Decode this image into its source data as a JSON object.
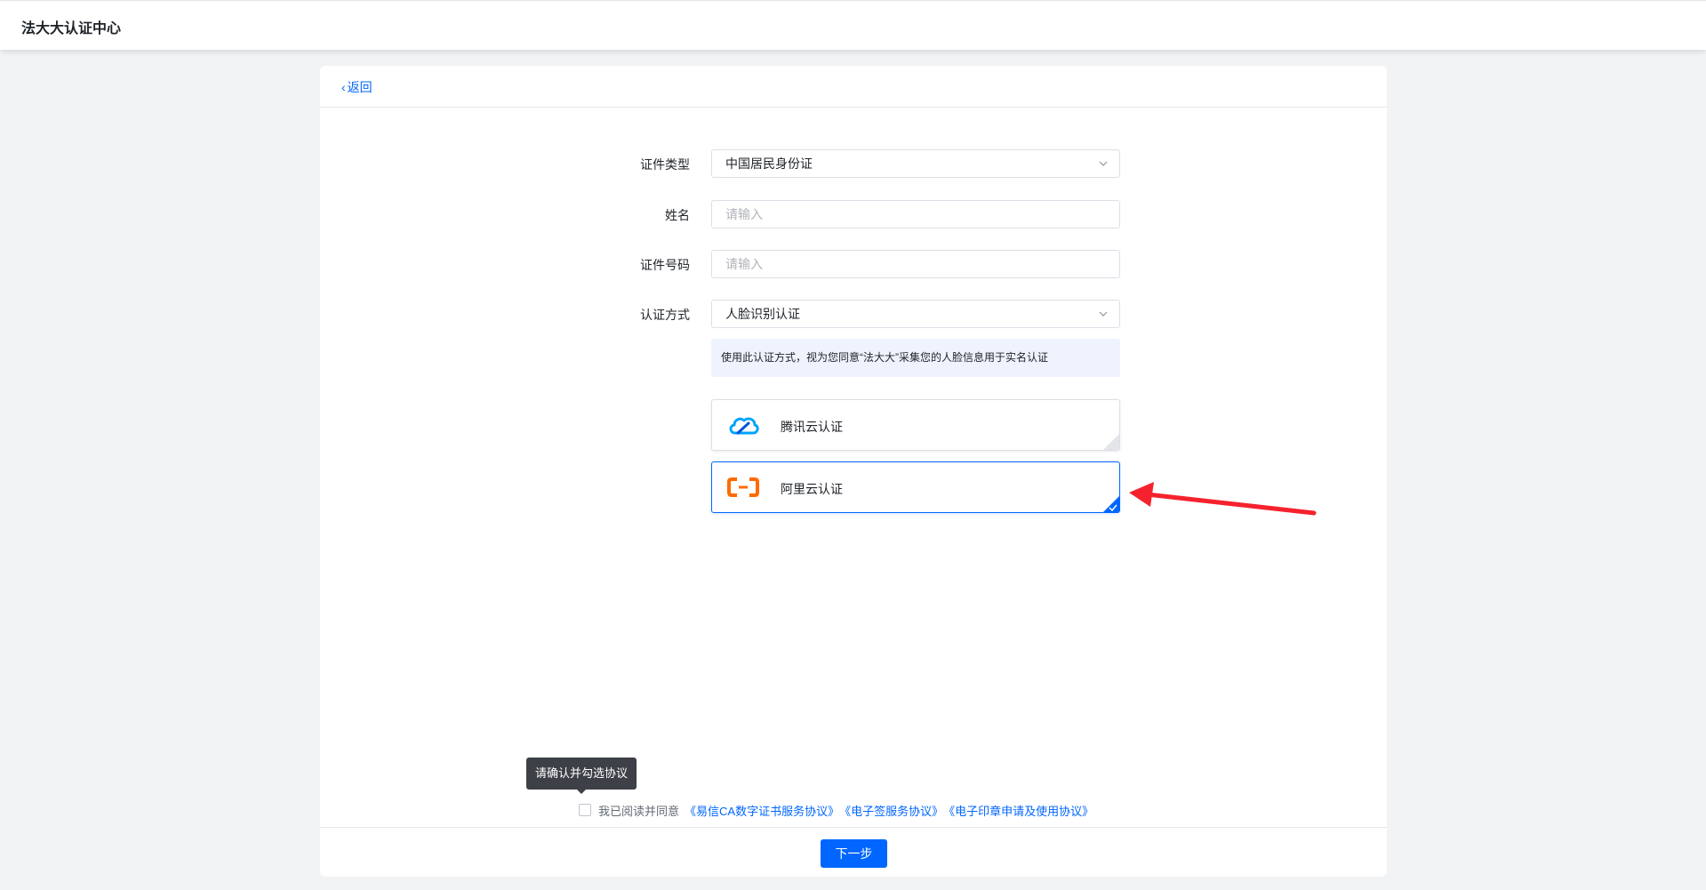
{
  "app": {
    "title": "法大大认证中心"
  },
  "header": {
    "back_label": "返回"
  },
  "form": {
    "id_type": {
      "label": "证件类型",
      "value": "中国居民身份证"
    },
    "name": {
      "label": "姓名",
      "placeholder": "请输入"
    },
    "id_number": {
      "label": "证件号码",
      "placeholder": "请输入"
    },
    "auth_method": {
      "label": "认证方式",
      "value": "人脸识别认证"
    },
    "notice": "使用此认证方式，视为您同意“法大大”采集您的人脸信息用于实名认证"
  },
  "providers": [
    {
      "name": "腾讯云认证",
      "icon": "tencent-cloud-icon",
      "selected": false
    },
    {
      "name": "阿里云认证",
      "icon": "aliyun-icon",
      "selected": true
    }
  ],
  "agreement": {
    "tooltip": "请确认并勾选协议",
    "prefix": "我已阅读并同意",
    "links": [
      "《易信CA数字证书服务协议》",
      "《电子签服务协议》",
      "《电子印章申请及使用协议》"
    ],
    "checked": false
  },
  "footer": {
    "next_label": "下一步"
  },
  "colors": {
    "accent": "#0066ff",
    "tencent_blue": "#00a3ff",
    "aliyun_orange": "#ff6a00",
    "annotation_red": "#f5222d"
  }
}
